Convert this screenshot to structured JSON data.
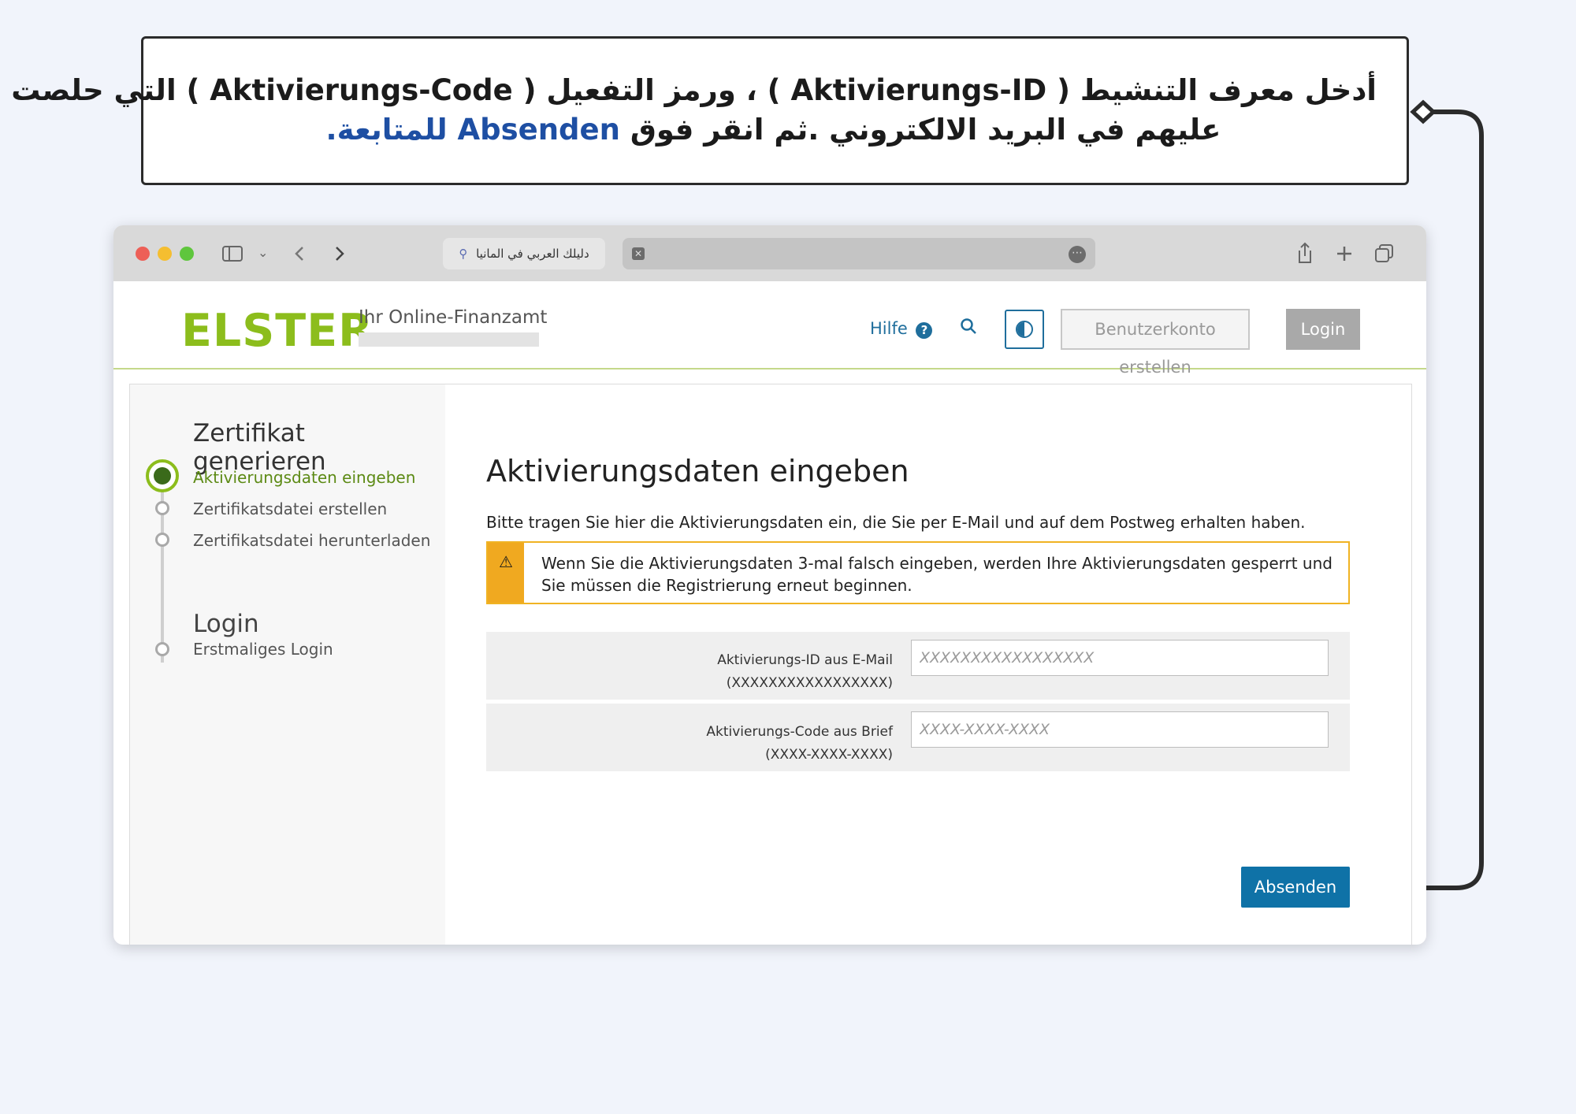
{
  "instruction": {
    "line1": "أدخل معرف التنشيط ( Aktivierungs-ID ) ، ورمز التفعيل  ( Aktivierungs-Code ) التي حلصت",
    "line2_pre": "عليهم في البريد الالكتروني .ثم انقر فوق ",
    "line2_highlight": "Absenden للمتابعة."
  },
  "browser": {
    "tab_title": "دليلك العربي في المانيا"
  },
  "header": {
    "logo": "ELSTER",
    "logo_subtitle": "Ihr Online-Finanzamt",
    "help_label": "Hilfe",
    "help_icon_glyph": "?",
    "create_account_label": "Benutzerkonto erstellen",
    "login_label": "Login"
  },
  "sidebar": {
    "title": "Zertifikat generieren",
    "steps": [
      {
        "label": "Aktivierungsdaten eingeben",
        "state": "active"
      },
      {
        "label": "Zertifikatsdatei erstellen",
        "state": "pending"
      },
      {
        "label": "Zertifikatsdatei herunterladen",
        "state": "pending"
      }
    ],
    "login_title": "Login",
    "login_steps": [
      {
        "label": "Erstmaliges Login",
        "state": "pending"
      }
    ]
  },
  "main": {
    "title": "Aktivierungsdaten eingeben",
    "intro": "Bitte tragen Sie hier die Aktivierungsdaten ein, die Sie per E-Mail und auf dem Postweg erhalten haben.",
    "warning": "Wenn Sie die Aktivierungsdaten 3-mal falsch eingeben, werden Ihre Aktivierungsdaten gesperrt und Sie müssen die Registrierung erneut beginnen.",
    "fields": [
      {
        "label": "Aktivierungs-ID aus E-Mail",
        "hint": "(XXXXXXXXXXXXXXXXX)",
        "placeholder": "XXXXXXXXXXXXXXXXX"
      },
      {
        "label": "Aktivierungs-Code aus Brief",
        "hint": "(XXXX-XXXX-XXXX)",
        "placeholder": "XXXX-XXXX-XXXX"
      }
    ],
    "submit_label": "Absenden"
  },
  "colors": {
    "elster_green": "#8cbd1c",
    "primary_blue": "#0f72a7",
    "warning_orange": "#f0a920",
    "highlight_blue": "#1e4fa3"
  }
}
